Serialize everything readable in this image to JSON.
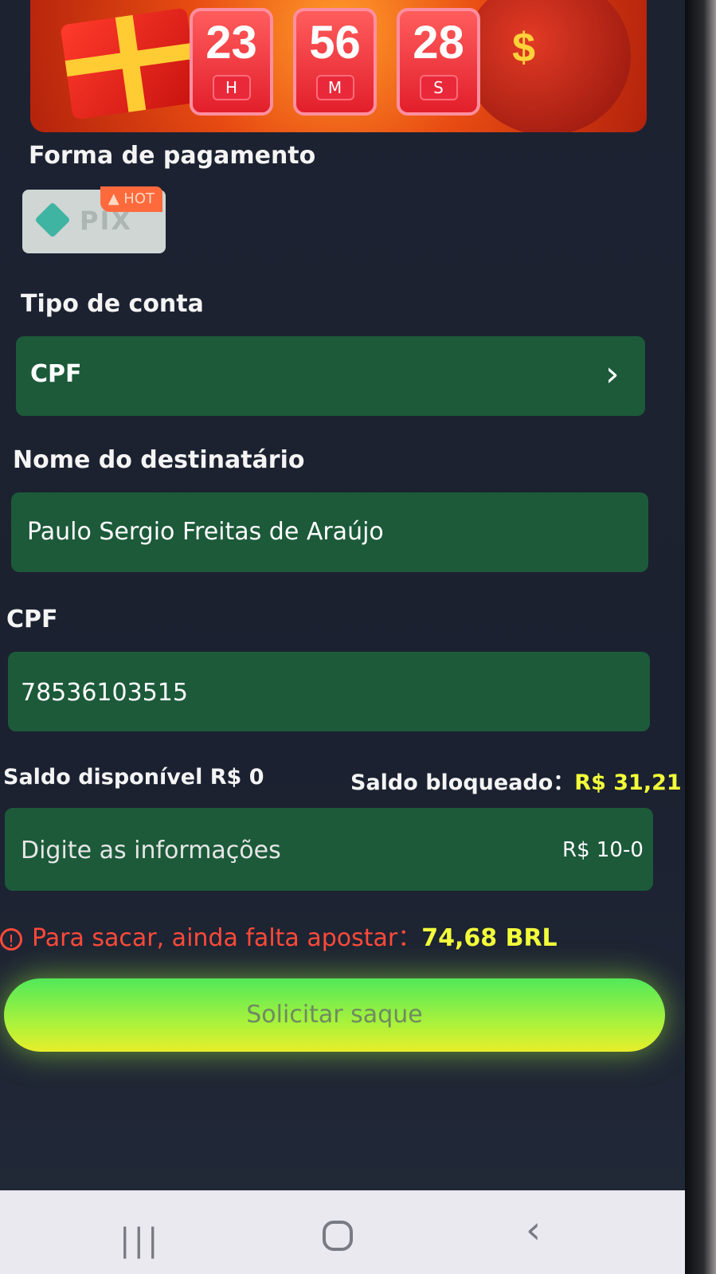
{
  "countdown": {
    "hours": "23",
    "hours_unit": "H",
    "minutes": "56",
    "minutes_unit": "M",
    "seconds": "28",
    "seconds_unit": "S"
  },
  "payment": {
    "label": "Forma de pagamento",
    "method": "PIX",
    "hot_badge": "HOT"
  },
  "account_type": {
    "label": "Tipo de conta",
    "value": "CPF"
  },
  "recipient": {
    "label": "Nome do destinatário",
    "value": "Paulo Sergio Freitas de Araújo"
  },
  "cpf": {
    "label": "CPF",
    "value": "78536103515"
  },
  "balance": {
    "available": "Saldo disponível R$ 0",
    "blocked_label": "Saldo bloqueado：",
    "blocked_value": "R$ 31,21"
  },
  "amount": {
    "placeholder": "Digite as informações",
    "range": "R$ 10-0"
  },
  "notice": {
    "text": "Para sacar, ainda falta apostar：",
    "amount": "74,68 BRL"
  },
  "submit_label": "Solicitar saque",
  "colors": {
    "field_green": "#1c5a3a",
    "warning_red": "#ff4a3a",
    "highlight_yellow": "#f3ff3a"
  }
}
